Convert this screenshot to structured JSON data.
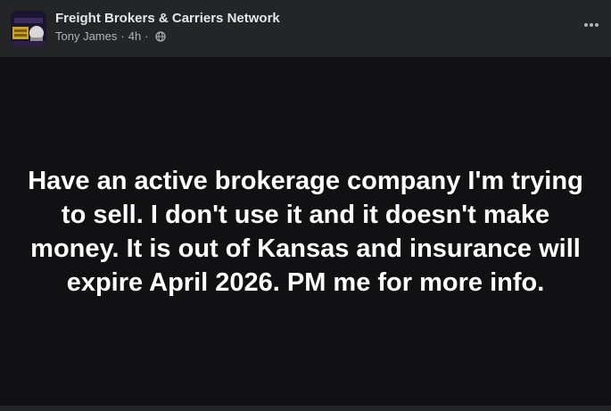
{
  "post": {
    "group_name": "Freight Brokers & Carriers Network",
    "author": "Tony James",
    "separator": "·",
    "time": "4h",
    "privacy_icon": "globe-icon",
    "menu_icon": "more-options-icon",
    "body_text": "Have an active brokerage company I'm trying to sell. I don't use it and it doesn't make money. It is out of Kansas and insurance will expire April 2026. PM me for more info."
  },
  "colors": {
    "header_bg": "#242526",
    "body_bg": "#111113",
    "text_primary": "#e4e6eb",
    "text_secondary": "#b0b3b8",
    "body_text": "#ffffff"
  }
}
